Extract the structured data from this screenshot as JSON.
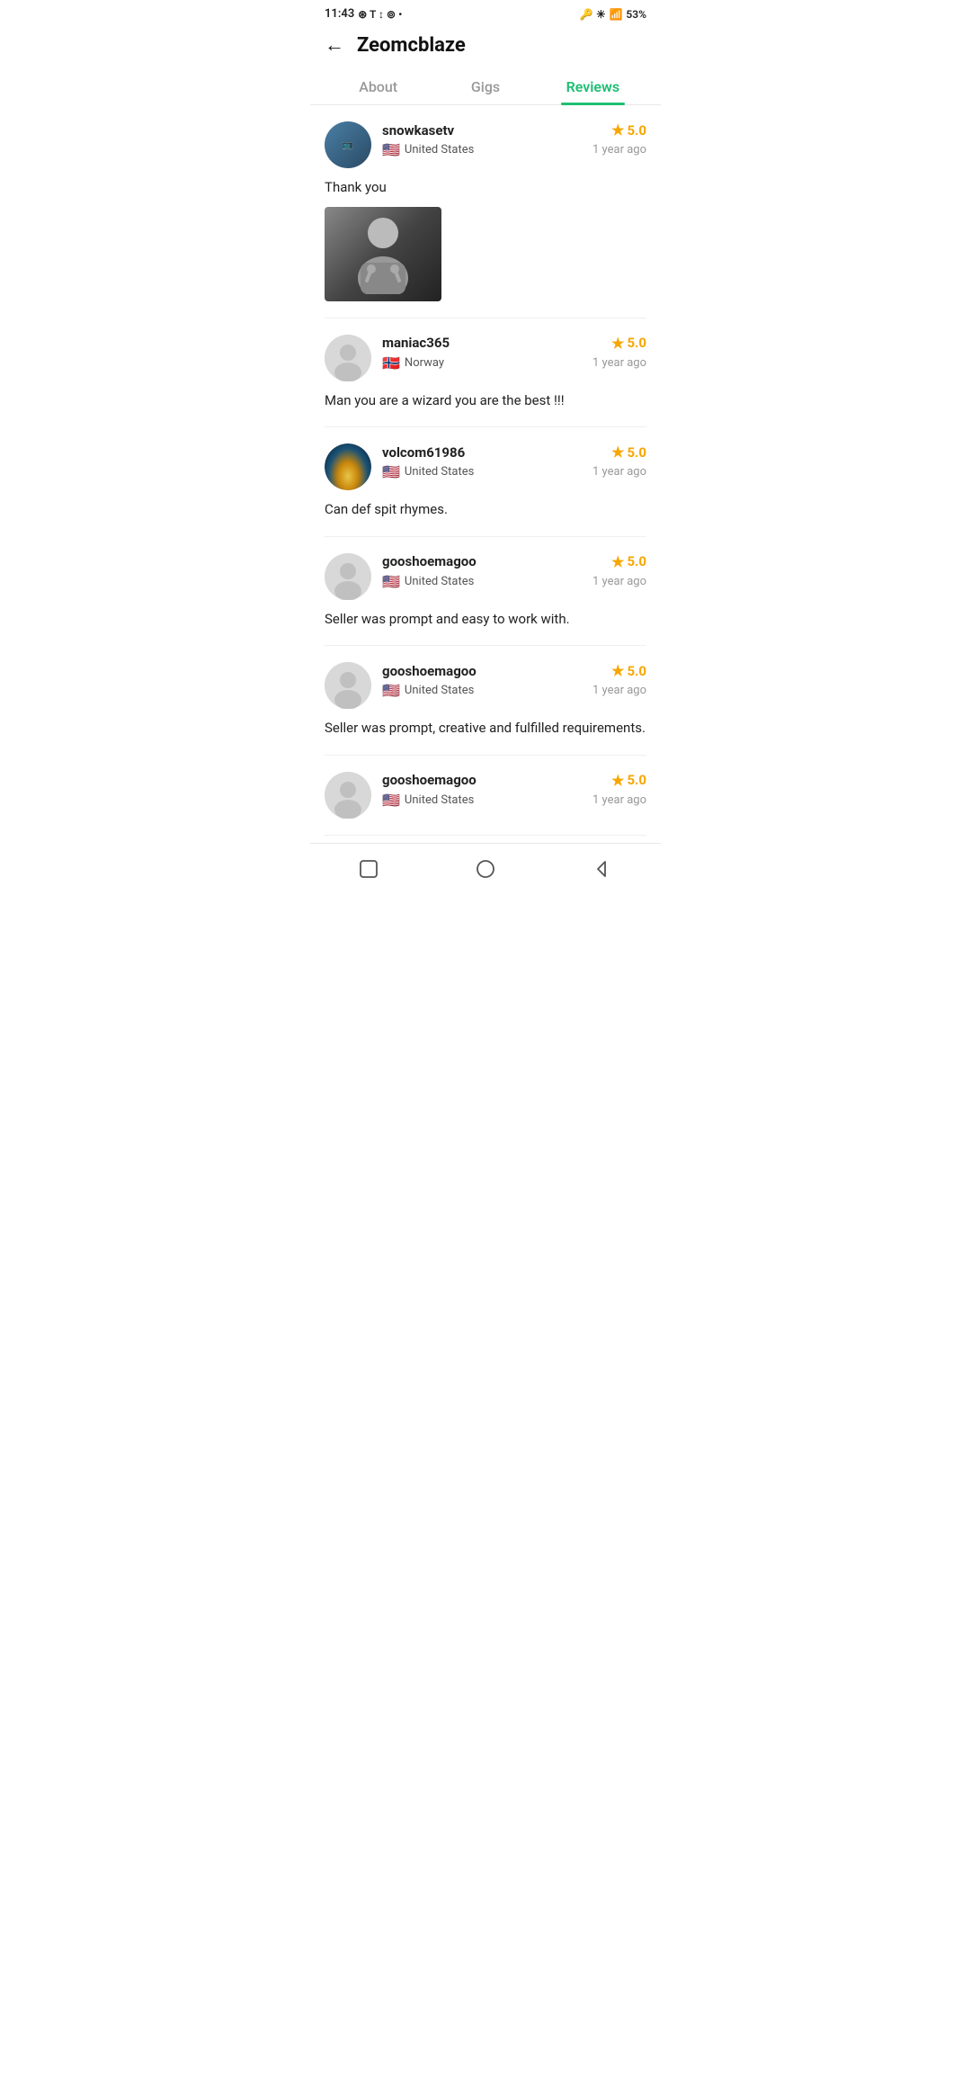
{
  "statusBar": {
    "time": "11:43",
    "battery": "53%"
  },
  "header": {
    "title": "Zeomcblaze",
    "backLabel": "←"
  },
  "tabs": [
    {
      "id": "about",
      "label": "About",
      "active": false
    },
    {
      "id": "gigs",
      "label": "Gigs",
      "active": false
    },
    {
      "id": "reviews",
      "label": "Reviews",
      "active": true
    }
  ],
  "reviews": [
    {
      "id": 1,
      "username": "snowkasetv",
      "country": "United States",
      "countryFlag": "us",
      "rating": "5.0",
      "timeAgo": "1 year ago",
      "text": "Thank you",
      "hasImage": true,
      "hasAvatar": true
    },
    {
      "id": 2,
      "username": "maniac365",
      "country": "Norway",
      "countryFlag": "no",
      "rating": "5.0",
      "timeAgo": "1 year ago",
      "text": "Man you are a wizard you are the best !!!",
      "hasImage": false,
      "hasAvatar": false
    },
    {
      "id": 3,
      "username": "volcom61986",
      "country": "United States",
      "countryFlag": "us",
      "rating": "5.0",
      "timeAgo": "1 year ago",
      "text": "Can def spit rhymes.",
      "hasImage": false,
      "hasAvatar": true,
      "avatarType": "landscape"
    },
    {
      "id": 4,
      "username": "gooshoemagoo",
      "country": "United States",
      "countryFlag": "us",
      "rating": "5.0",
      "timeAgo": "1 year ago",
      "text": "Seller was prompt and easy to work with.",
      "hasImage": false,
      "hasAvatar": false
    },
    {
      "id": 5,
      "username": "gooshoemagoo",
      "country": "United States",
      "countryFlag": "us",
      "rating": "5.0",
      "timeAgo": "1 year ago",
      "text": "Seller was prompt, creative and fulfilled requirements.",
      "hasImage": false,
      "hasAvatar": false
    },
    {
      "id": 6,
      "username": "gooshoemagoo",
      "country": "United States",
      "countryFlag": "us",
      "rating": "5.0",
      "timeAgo": "1 year ago",
      "text": "",
      "hasImage": false,
      "hasAvatar": false
    }
  ]
}
